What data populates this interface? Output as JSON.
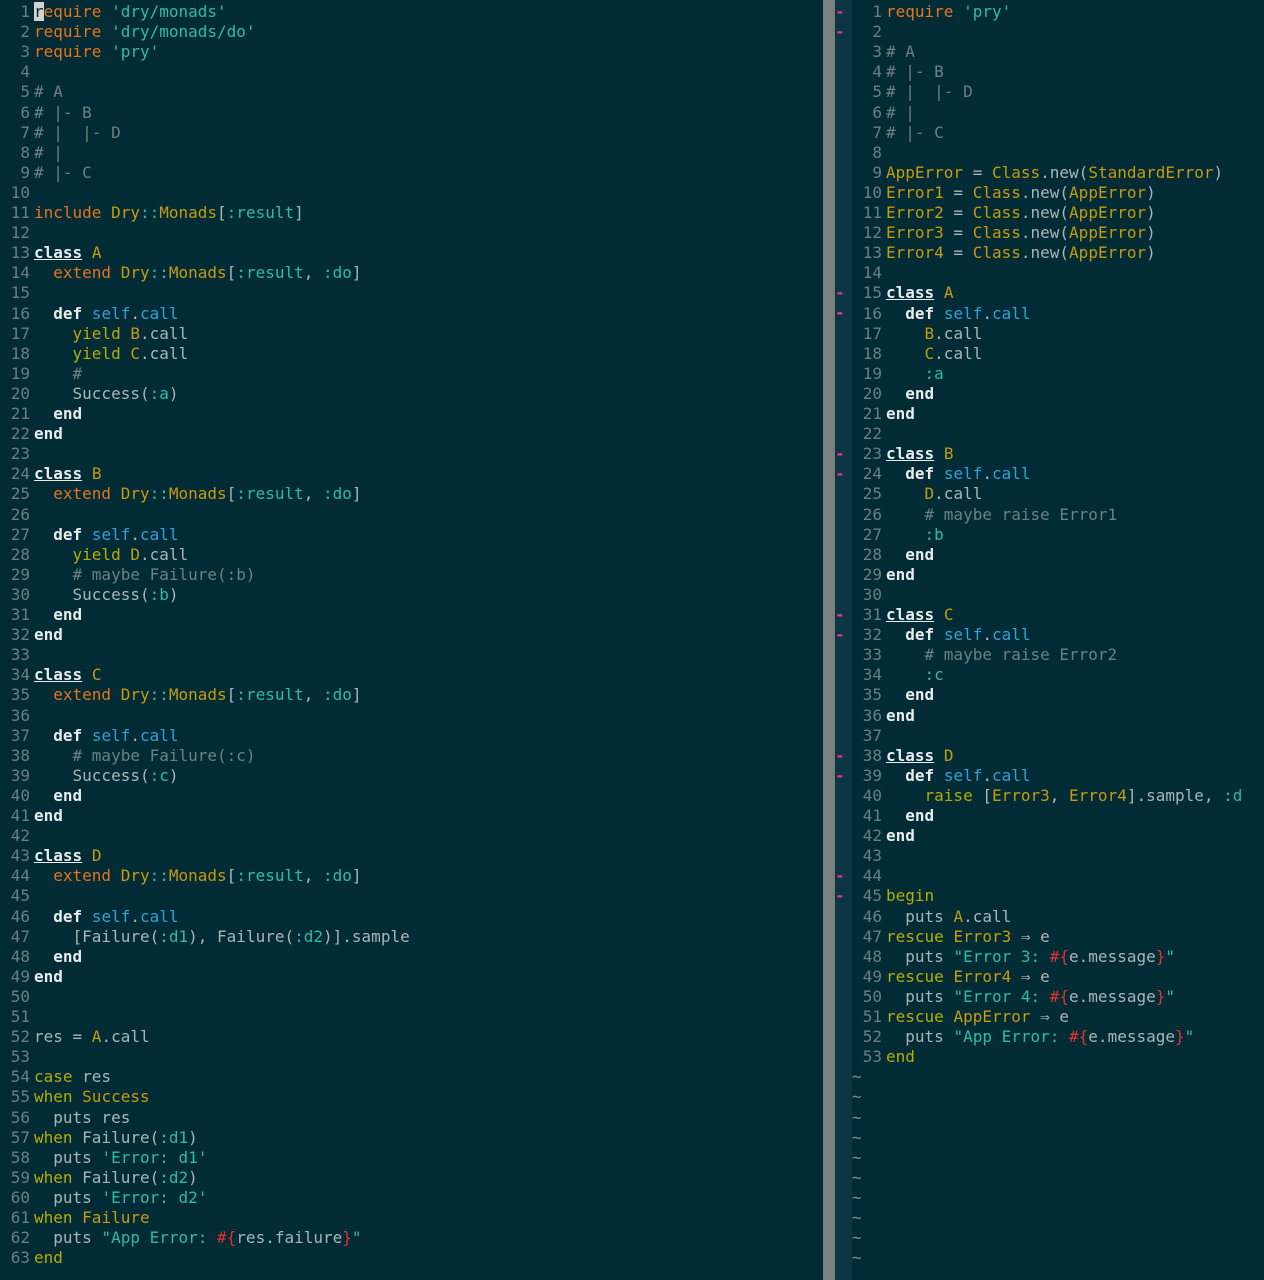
{
  "left_pane": {
    "lines": [
      [
        [
          "cursor",
          "r"
        ],
        [
          "kw",
          "equire "
        ],
        [
          "str",
          "'dry/monads'"
        ]
      ],
      [
        [
          "kw",
          "require "
        ],
        [
          "str",
          "'dry/monads/do'"
        ]
      ],
      [
        [
          "kw",
          "require "
        ],
        [
          "str",
          "'pry'"
        ]
      ],
      [],
      [
        [
          "com",
          "# A"
        ]
      ],
      [
        [
          "com",
          "# |- B"
        ]
      ],
      [
        [
          "com",
          "# |  |- D"
        ]
      ],
      [
        [
          "com",
          "# |"
        ]
      ],
      [
        [
          "com",
          "# |- C"
        ]
      ],
      [],
      [
        [
          "kw",
          "include "
        ],
        [
          "cls",
          "Dry"
        ],
        [
          "sym",
          "::"
        ],
        [
          "cls",
          "Monads"
        ],
        [
          "",
          "["
        ],
        [
          "sym",
          ":result"
        ],
        [
          "",
          "]"
        ]
      ],
      [],
      [
        [
          "kwc",
          "class"
        ],
        [
          "",
          " "
        ],
        [
          "cls",
          "A"
        ]
      ],
      [
        [
          "",
          "  "
        ],
        [
          "kw",
          "extend "
        ],
        [
          "cls",
          "Dry"
        ],
        [
          "sym",
          "::"
        ],
        [
          "cls",
          "Monads"
        ],
        [
          "",
          "["
        ],
        [
          "sym",
          ":result"
        ],
        [
          "",
          ", "
        ],
        [
          "sym",
          ":do"
        ],
        [
          "",
          "]"
        ]
      ],
      [],
      [
        [
          "",
          "  "
        ],
        [
          "kwb",
          "def"
        ],
        [
          "",
          " "
        ],
        [
          "meth",
          "self"
        ],
        [
          "",
          "."
        ],
        [
          "meth",
          "call"
        ]
      ],
      [
        [
          "",
          "    "
        ],
        [
          "kwy",
          "yield"
        ],
        [
          "",
          " "
        ],
        [
          "cls",
          "B"
        ],
        [
          "",
          ".call"
        ]
      ],
      [
        [
          "",
          "    "
        ],
        [
          "kwy",
          "yield"
        ],
        [
          "",
          " "
        ],
        [
          "cls",
          "C"
        ],
        [
          "",
          ".call"
        ]
      ],
      [
        [
          "",
          "    "
        ],
        [
          "com",
          "#"
        ]
      ],
      [
        [
          "",
          "    Success("
        ],
        [
          "sym",
          ":a"
        ],
        [
          "",
          ")"
        ]
      ],
      [
        [
          "",
          "  "
        ],
        [
          "kwb",
          "end"
        ]
      ],
      [
        [
          "kwb",
          "end"
        ]
      ],
      [],
      [
        [
          "kwc",
          "class"
        ],
        [
          "",
          " "
        ],
        [
          "cls",
          "B"
        ]
      ],
      [
        [
          "",
          "  "
        ],
        [
          "kw",
          "extend "
        ],
        [
          "cls",
          "Dry"
        ],
        [
          "sym",
          "::"
        ],
        [
          "cls",
          "Monads"
        ],
        [
          "",
          "["
        ],
        [
          "sym",
          ":result"
        ],
        [
          "",
          ", "
        ],
        [
          "sym",
          ":do"
        ],
        [
          "",
          "]"
        ]
      ],
      [],
      [
        [
          "",
          "  "
        ],
        [
          "kwb",
          "def"
        ],
        [
          "",
          " "
        ],
        [
          "meth",
          "self"
        ],
        [
          "",
          "."
        ],
        [
          "meth",
          "call"
        ]
      ],
      [
        [
          "",
          "    "
        ],
        [
          "kwy",
          "yield"
        ],
        [
          "",
          " "
        ],
        [
          "cls",
          "D"
        ],
        [
          "",
          ".call"
        ]
      ],
      [
        [
          "",
          "    "
        ],
        [
          "com",
          "# maybe Failure(:b)"
        ]
      ],
      [
        [
          "",
          "    Success("
        ],
        [
          "sym",
          ":b"
        ],
        [
          "",
          ")"
        ]
      ],
      [
        [
          "",
          "  "
        ],
        [
          "kwb",
          "end"
        ]
      ],
      [
        [
          "kwb",
          "end"
        ]
      ],
      [],
      [
        [
          "kwc",
          "class"
        ],
        [
          "",
          " "
        ],
        [
          "cls",
          "C"
        ]
      ],
      [
        [
          "",
          "  "
        ],
        [
          "kw",
          "extend "
        ],
        [
          "cls",
          "Dry"
        ],
        [
          "sym",
          "::"
        ],
        [
          "cls",
          "Monads"
        ],
        [
          "",
          "["
        ],
        [
          "sym",
          ":result"
        ],
        [
          "",
          ", "
        ],
        [
          "sym",
          ":do"
        ],
        [
          "",
          "]"
        ]
      ],
      [],
      [
        [
          "",
          "  "
        ],
        [
          "kwb",
          "def"
        ],
        [
          "",
          " "
        ],
        [
          "meth",
          "self"
        ],
        [
          "",
          "."
        ],
        [
          "meth",
          "call"
        ]
      ],
      [
        [
          "",
          "    "
        ],
        [
          "com",
          "# maybe Failure(:c)"
        ]
      ],
      [
        [
          "",
          "    Success("
        ],
        [
          "sym",
          ":c"
        ],
        [
          "",
          ")"
        ]
      ],
      [
        [
          "",
          "  "
        ],
        [
          "kwb",
          "end"
        ]
      ],
      [
        [
          "kwb",
          "end"
        ]
      ],
      [],
      [
        [
          "kwc",
          "class"
        ],
        [
          "",
          " "
        ],
        [
          "cls",
          "D"
        ]
      ],
      [
        [
          "",
          "  "
        ],
        [
          "kw",
          "extend "
        ],
        [
          "cls",
          "Dry"
        ],
        [
          "sym",
          "::"
        ],
        [
          "cls",
          "Monads"
        ],
        [
          "",
          "["
        ],
        [
          "sym",
          ":result"
        ],
        [
          "",
          ", "
        ],
        [
          "sym",
          ":do"
        ],
        [
          "",
          "]"
        ]
      ],
      [],
      [
        [
          "",
          "  "
        ],
        [
          "kwb",
          "def"
        ],
        [
          "",
          " "
        ],
        [
          "meth",
          "self"
        ],
        [
          "",
          "."
        ],
        [
          "meth",
          "call"
        ]
      ],
      [
        [
          "",
          "    [Failure("
        ],
        [
          "sym",
          ":d1"
        ],
        [
          "",
          "), Failure("
        ],
        [
          "sym",
          ":d2"
        ],
        [
          "",
          ")].sample"
        ]
      ],
      [
        [
          "",
          "  "
        ],
        [
          "kwb",
          "end"
        ]
      ],
      [
        [
          "kwb",
          "end"
        ]
      ],
      [],
      [],
      [
        [
          "",
          "res = "
        ],
        [
          "cls",
          "A"
        ],
        [
          "",
          ".call"
        ]
      ],
      [],
      [
        [
          "kwy",
          "case"
        ],
        [
          "",
          " res"
        ]
      ],
      [
        [
          "kwy",
          "when"
        ],
        [
          "",
          " "
        ],
        [
          "cls",
          "Success"
        ]
      ],
      [
        [
          "",
          "  puts res"
        ]
      ],
      [
        [
          "kwy",
          "when"
        ],
        [
          "",
          " Failure("
        ],
        [
          "sym",
          ":d1"
        ],
        [
          "",
          ")"
        ]
      ],
      [
        [
          "",
          "  puts "
        ],
        [
          "str",
          "'Error: d1'"
        ]
      ],
      [
        [
          "kwy",
          "when"
        ],
        [
          "",
          " Failure("
        ],
        [
          "sym",
          ":d2"
        ],
        [
          "",
          ")"
        ]
      ],
      [
        [
          "",
          "  puts "
        ],
        [
          "str",
          "'Error: d2'"
        ]
      ],
      [
        [
          "kwy",
          "when"
        ],
        [
          "",
          " "
        ],
        [
          "cls",
          "Failure"
        ]
      ],
      [
        [
          "",
          "  puts "
        ],
        [
          "str",
          "\"App Error: "
        ],
        [
          "hash",
          "#{"
        ],
        [
          "",
          "res.failure"
        ],
        [
          "hash",
          "}"
        ],
        [
          "str",
          "\""
        ]
      ],
      [
        [
          "kwy",
          "end"
        ]
      ]
    ]
  },
  "right_pane": {
    "fold_marker": "--",
    "fold_lines": [
      1,
      15,
      23,
      31,
      38,
      44
    ],
    "lines": [
      [
        [
          "kw",
          "require "
        ],
        [
          "str",
          "'pry'"
        ]
      ],
      [],
      [
        [
          "com",
          "# A"
        ]
      ],
      [
        [
          "com",
          "# |- B"
        ]
      ],
      [
        [
          "com",
          "# |  |- D"
        ]
      ],
      [
        [
          "com",
          "# |"
        ]
      ],
      [
        [
          "com",
          "# |- C"
        ]
      ],
      [],
      [
        [
          "cls",
          "AppError"
        ],
        [
          "",
          " = "
        ],
        [
          "cls",
          "Class"
        ],
        [
          "",
          ".new("
        ],
        [
          "cls",
          "StandardError"
        ],
        [
          "",
          ")"
        ]
      ],
      [
        [
          "cls",
          "Error1"
        ],
        [
          "",
          " = "
        ],
        [
          "cls",
          "Class"
        ],
        [
          "",
          ".new("
        ],
        [
          "cls",
          "AppError"
        ],
        [
          "",
          ")"
        ]
      ],
      [
        [
          "cls",
          "Error2"
        ],
        [
          "",
          " = "
        ],
        [
          "cls",
          "Class"
        ],
        [
          "",
          ".new("
        ],
        [
          "cls",
          "AppError"
        ],
        [
          "",
          ")"
        ]
      ],
      [
        [
          "cls",
          "Error3"
        ],
        [
          "",
          " = "
        ],
        [
          "cls",
          "Class"
        ],
        [
          "",
          ".new("
        ],
        [
          "cls",
          "AppError"
        ],
        [
          "",
          ")"
        ]
      ],
      [
        [
          "cls",
          "Error4"
        ],
        [
          "",
          " = "
        ],
        [
          "cls",
          "Class"
        ],
        [
          "",
          ".new("
        ],
        [
          "cls",
          "AppError"
        ],
        [
          "",
          ")"
        ]
      ],
      [],
      [
        [
          "kwc",
          "class"
        ],
        [
          "",
          " "
        ],
        [
          "cls",
          "A"
        ]
      ],
      [
        [
          "",
          "  "
        ],
        [
          "kwb",
          "def"
        ],
        [
          "",
          " "
        ],
        [
          "meth",
          "self"
        ],
        [
          "",
          "."
        ],
        [
          "meth",
          "call"
        ]
      ],
      [
        [
          "",
          "    "
        ],
        [
          "cls",
          "B"
        ],
        [
          "",
          ".call"
        ]
      ],
      [
        [
          "",
          "    "
        ],
        [
          "cls",
          "C"
        ],
        [
          "",
          ".call"
        ]
      ],
      [
        [
          "",
          "    "
        ],
        [
          "sym",
          ":a"
        ]
      ],
      [
        [
          "",
          "  "
        ],
        [
          "kwb",
          "end"
        ]
      ],
      [
        [
          "kwb",
          "end"
        ]
      ],
      [],
      [
        [
          "kwc",
          "class"
        ],
        [
          "",
          " "
        ],
        [
          "cls",
          "B"
        ]
      ],
      [
        [
          "",
          "  "
        ],
        [
          "kwb",
          "def"
        ],
        [
          "",
          " "
        ],
        [
          "meth",
          "self"
        ],
        [
          "",
          "."
        ],
        [
          "meth",
          "call"
        ]
      ],
      [
        [
          "",
          "    "
        ],
        [
          "cls",
          "D"
        ],
        [
          "",
          ".call"
        ]
      ],
      [
        [
          "",
          "    "
        ],
        [
          "com",
          "# maybe raise Error1"
        ]
      ],
      [
        [
          "",
          "    "
        ],
        [
          "sym",
          ":b"
        ]
      ],
      [
        [
          "",
          "  "
        ],
        [
          "kwb",
          "end"
        ]
      ],
      [
        [
          "kwb",
          "end"
        ]
      ],
      [],
      [
        [
          "kwc",
          "class"
        ],
        [
          "",
          " "
        ],
        [
          "cls",
          "C"
        ]
      ],
      [
        [
          "",
          "  "
        ],
        [
          "kwb",
          "def"
        ],
        [
          "",
          " "
        ],
        [
          "meth",
          "self"
        ],
        [
          "",
          "."
        ],
        [
          "meth",
          "call"
        ]
      ],
      [
        [
          "",
          "    "
        ],
        [
          "com",
          "# maybe raise Error2"
        ]
      ],
      [
        [
          "",
          "    "
        ],
        [
          "sym",
          ":c"
        ]
      ],
      [
        [
          "",
          "  "
        ],
        [
          "kwb",
          "end"
        ]
      ],
      [
        [
          "kwb",
          "end"
        ]
      ],
      [],
      [
        [
          "kwc",
          "class"
        ],
        [
          "",
          " "
        ],
        [
          "cls",
          "D"
        ]
      ],
      [
        [
          "",
          "  "
        ],
        [
          "kwb",
          "def"
        ],
        [
          "",
          " "
        ],
        [
          "meth",
          "self"
        ],
        [
          "",
          "."
        ],
        [
          "meth",
          "call"
        ]
      ],
      [
        [
          "",
          "    "
        ],
        [
          "kwy",
          "raise"
        ],
        [
          "",
          " ["
        ],
        [
          "cls",
          "Error3"
        ],
        [
          "",
          ", "
        ],
        [
          "cls",
          "Error4"
        ],
        [
          "",
          "].sample, "
        ],
        [
          "sym",
          ":d"
        ]
      ],
      [
        [
          "",
          "  "
        ],
        [
          "kwb",
          "end"
        ]
      ],
      [
        [
          "kwb",
          "end"
        ]
      ],
      [],
      [],
      [
        [
          "kwy",
          "begin"
        ]
      ],
      [
        [
          "",
          "  puts "
        ],
        [
          "cls",
          "A"
        ],
        [
          "",
          ".call"
        ]
      ],
      [
        [
          "kwy",
          "rescue"
        ],
        [
          "",
          " "
        ],
        [
          "cls",
          "Error3"
        ],
        [
          "",
          " ⇒ e"
        ]
      ],
      [
        [
          "",
          "  puts "
        ],
        [
          "str",
          "\"Error 3: "
        ],
        [
          "hash",
          "#{"
        ],
        [
          "",
          "e.message"
        ],
        [
          "hash",
          "}"
        ],
        [
          "str",
          "\""
        ]
      ],
      [
        [
          "kwy",
          "rescue"
        ],
        [
          "",
          " "
        ],
        [
          "cls",
          "Error4"
        ],
        [
          "",
          " ⇒ e"
        ]
      ],
      [
        [
          "",
          "  puts "
        ],
        [
          "str",
          "\"Error 4: "
        ],
        [
          "hash",
          "#{"
        ],
        [
          "",
          "e.message"
        ],
        [
          "hash",
          "}"
        ],
        [
          "str",
          "\""
        ]
      ],
      [
        [
          "kwy",
          "rescue"
        ],
        [
          "",
          " "
        ],
        [
          "cls",
          "AppError"
        ],
        [
          "",
          " ⇒ e"
        ]
      ],
      [
        [
          "",
          "  puts "
        ],
        [
          "str",
          "\"App Error: "
        ],
        [
          "hash",
          "#{"
        ],
        [
          "",
          "e.message"
        ],
        [
          "hash",
          "}"
        ],
        [
          "str",
          "\""
        ]
      ],
      [
        [
          "kwy",
          "end"
        ]
      ]
    ],
    "empty_line_marker": "~",
    "empty_line_count": 10
  }
}
